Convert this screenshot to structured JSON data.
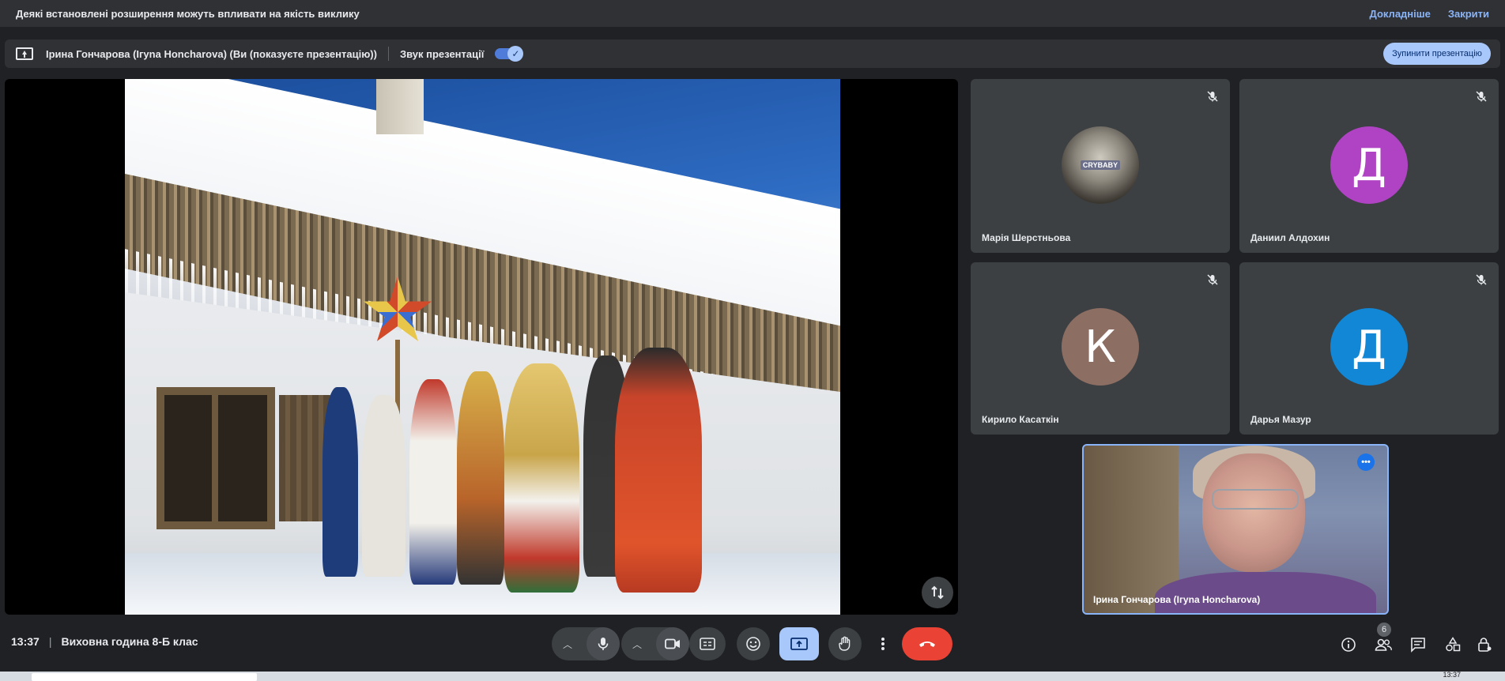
{
  "banner": {
    "message": "Деякі встановлені розширення можуть впливати на якість виклику",
    "details_link": "Докладніше",
    "close_link": "Закрити"
  },
  "presentation": {
    "presenter_text": "Ірина Гончарова (Ігуnа Honcharova) (Ви (показуєте презентацію))",
    "audio_label": "Звук презентації",
    "audio_enabled": true,
    "stop_button": "Зупинити презентацію"
  },
  "participants": [
    {
      "name": "Марія Шерстньова",
      "avatar_type": "photo",
      "photo_text": "CRYBABY",
      "muted": true
    },
    {
      "name": "Даниил Алдохин",
      "initial": "Д",
      "color": "#b043c4",
      "muted": true
    },
    {
      "name": "Кирило Касаткін",
      "initial": "К",
      "color": "#8d6e63",
      "muted": true
    },
    {
      "name": "Дарья Мазур",
      "initial": "Д",
      "color": "#1187d6",
      "muted": true
    }
  ],
  "self": {
    "name": "Ірина Гончарова (Ігуnа Honcharova)",
    "more_icon": "more-horiz-icon"
  },
  "meeting": {
    "time": "13:37",
    "title": "Виховна година 8-Б клас"
  },
  "controls": {
    "participants_count": "6"
  },
  "taskbar": {
    "clock": "13:37"
  },
  "colors": {
    "accent": "#a8c7fa",
    "end_call": "#ea4335",
    "link": "#8ab4f8",
    "background": "#202124"
  }
}
